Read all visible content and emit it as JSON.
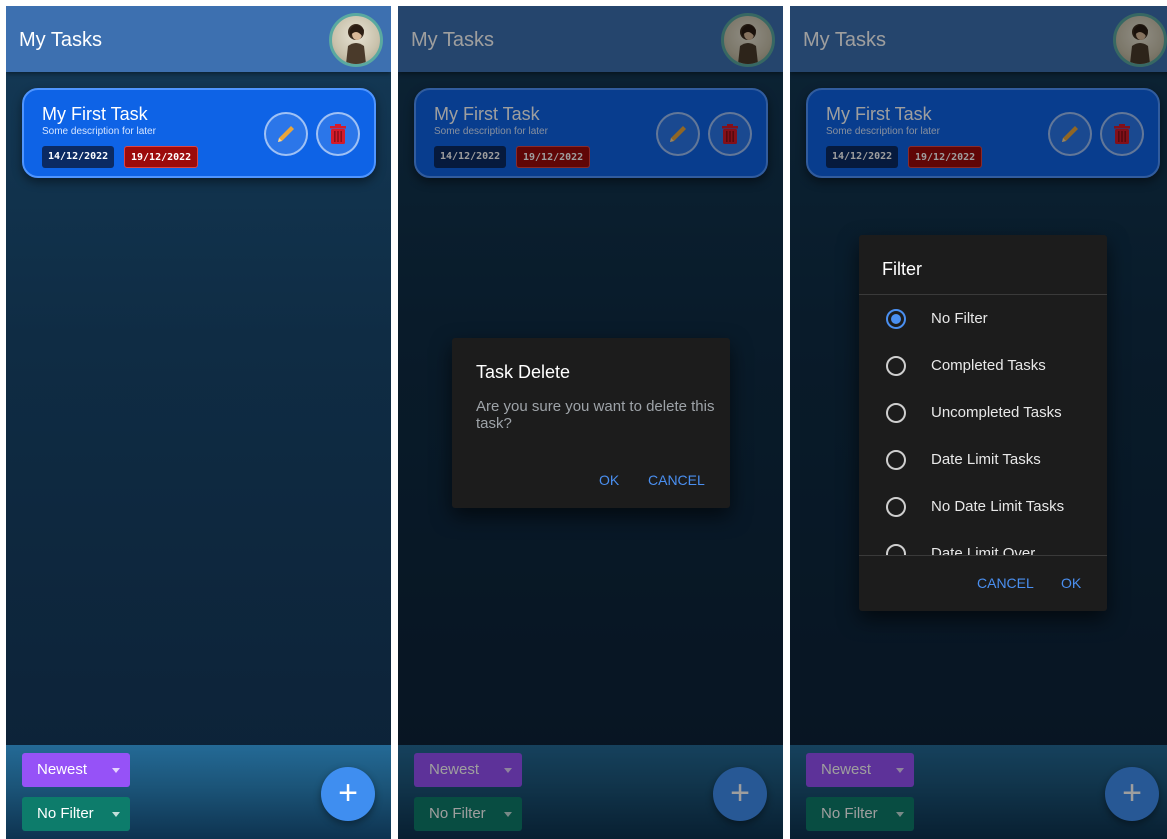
{
  "app": {
    "title": "My Tasks"
  },
  "task": {
    "title": "My First Task",
    "description": "Some description for later",
    "start_date": "14/12/2022",
    "end_date": "19/12/2022"
  },
  "bottom_bar": {
    "sort_label": "Newest",
    "filter_label": "No Filter",
    "add_icon": "plus-icon"
  },
  "delete_dialog": {
    "title": "Task Delete",
    "message": "Are you sure you want to delete this task?",
    "ok_label": "OK",
    "cancel_label": "CANCEL"
  },
  "filter_dialog": {
    "title": "Filter",
    "options": [
      {
        "label": "No Filter",
        "selected": true
      },
      {
        "label": "Completed Tasks",
        "selected": false
      },
      {
        "label": "Uncompleted Tasks",
        "selected": false
      },
      {
        "label": "Date Limit Tasks",
        "selected": false
      },
      {
        "label": "No Date Limit Tasks",
        "selected": false
      },
      {
        "label": "Date Limit Over",
        "selected": false
      }
    ],
    "cancel_label": "CANCEL",
    "ok_label": "OK"
  },
  "colors": {
    "app_bar": "#3d70b0",
    "card": "#0e63e6",
    "start_chip": "#0b2a63",
    "end_chip": "#9c0b0b",
    "sort_dropdown": "#9652f7",
    "filter_dropdown": "#0d7c6b",
    "fab": "#3f8ef0",
    "dialog_accent": "#4a8ff0"
  }
}
